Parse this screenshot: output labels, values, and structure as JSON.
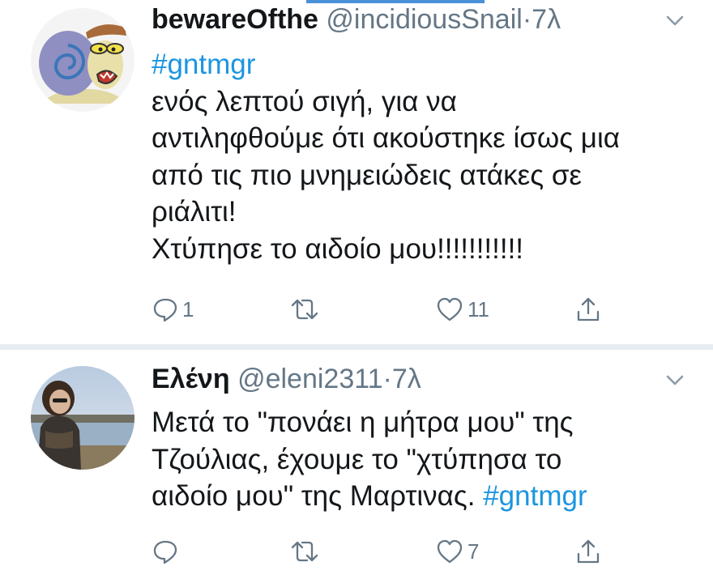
{
  "tweets": [
    {
      "author_name": "bewareOfthe",
      "handle": "@incidiousSnail",
      "separator": "·",
      "time": "7λ",
      "body_lines": [
        "#gntmgr",
        "ενός λεπτού σιγή, για να",
        "αντιληφθούμε ότι ακούστηκε ίσως μια",
        "από τις πιο μνημειώδεις ατάκες σε",
        "ριάλιτι!",
        "Χτύπησε το αιδοίο μου!!!!!!!!!!!"
      ],
      "replies": "1",
      "retweets": "",
      "likes": "11",
      "avatar_icon": "snail-cartoon-avatar"
    },
    {
      "author_name": "Ελένη",
      "handle": "@eleni2311",
      "separator": "·",
      "time": "7λ",
      "body_lines": [
        "Μετά το \"πονάει η μήτρα μου\" της",
        "Τζούλιας, έχουμε το \"χτύπησα το",
        "αιδοίο μου\" της Μαρτινας."
      ],
      "hashtag": "#gntmgr",
      "replies": "",
      "retweets": "",
      "likes": "7",
      "avatar_icon": "woman-lakeside-photo-avatar"
    }
  ],
  "colors": {
    "text": "#14171a",
    "muted": "#657786",
    "link": "#1b95e0",
    "divider": "#e6ecf0"
  },
  "icons": [
    "reply-icon",
    "retweet-icon",
    "like-icon",
    "share-icon",
    "chevron-down-icon"
  ]
}
